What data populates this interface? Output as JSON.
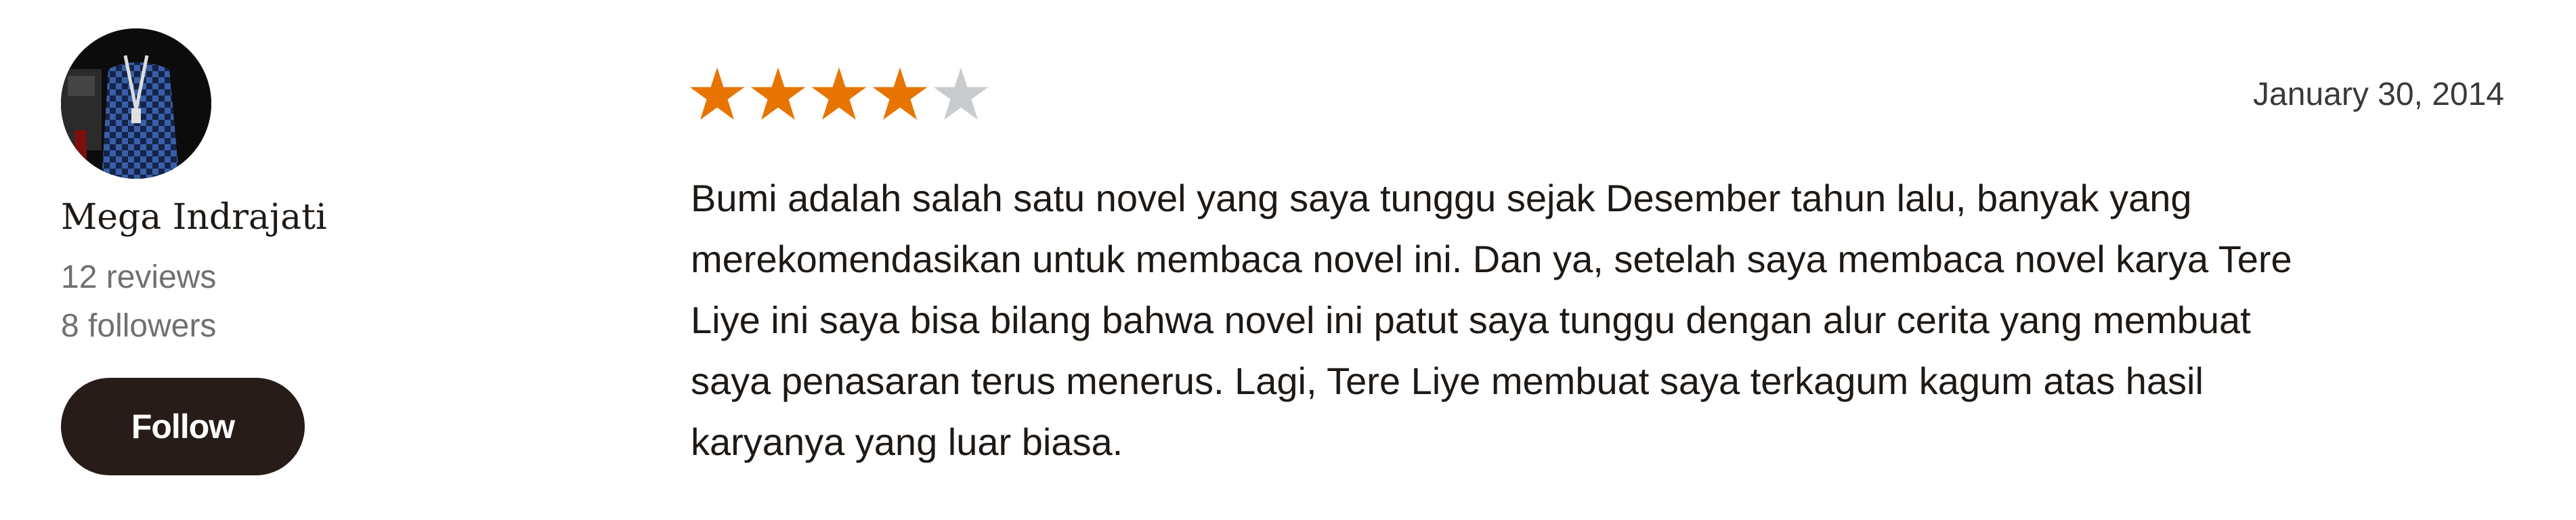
{
  "reviewer": {
    "name": "Mega Indrajati",
    "reviews": "12 reviews",
    "followers": "8 followers",
    "follow_label": "Follow"
  },
  "review": {
    "rating": 4,
    "rating_max": 5,
    "date": "January 30, 2014",
    "lines": [
      "Bumi adalah salah satu novel yang saya tunggu sejak Desember tahun lalu, banyak yang",
      "merekomendasikan untuk membaca novel ini. Dan ya, setelah saya membaca novel karya Tere",
      "Liye ini saya bisa bilang bahwa novel ini patut saya tunggu dengan alur cerita yang membuat",
      "saya penasaran terus menerus. Lagi, Tere Liye membuat saya terkagum kagum atas hasil",
      "karyanya yang luar biasa."
    ]
  },
  "colors": {
    "star_filled": "#e87400",
    "star_empty": "#c8ccce",
    "follow_button_bg": "#271c18"
  },
  "icons": {
    "star": "star-icon"
  }
}
